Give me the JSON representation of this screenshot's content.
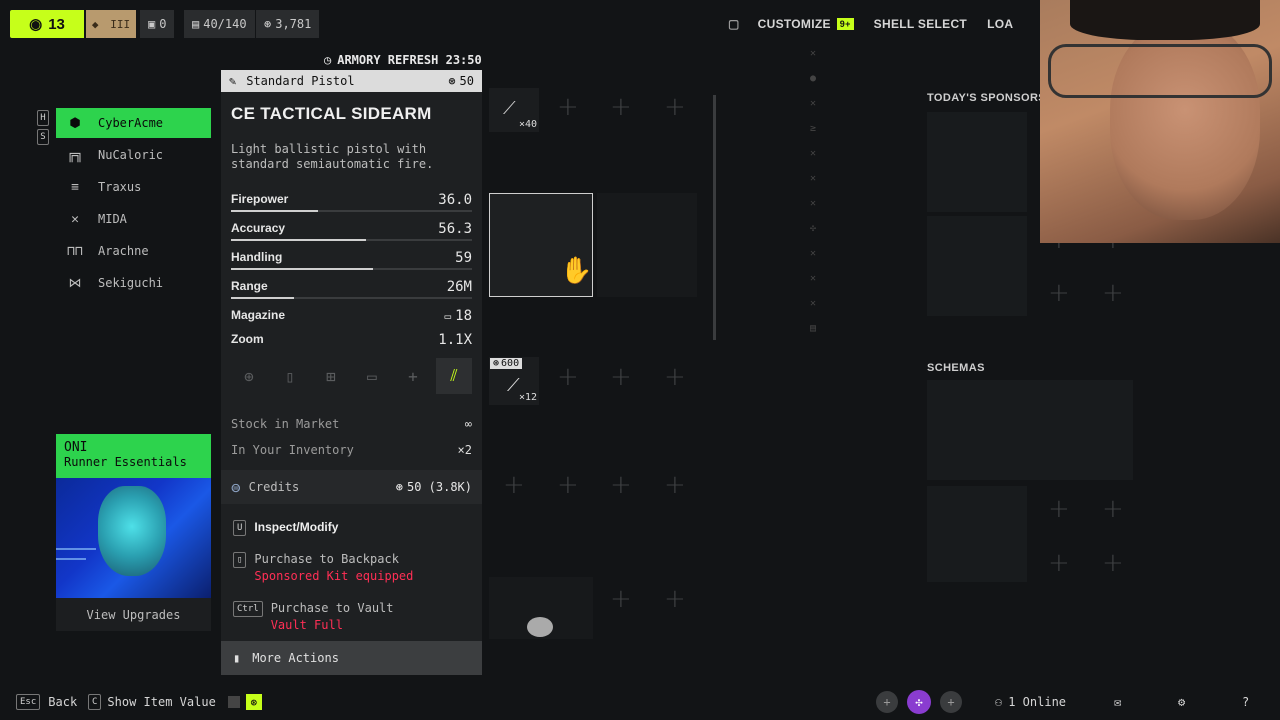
{
  "hud": {
    "level": "13",
    "tan_icons": [
      "◆",
      "III"
    ],
    "count_a": "0",
    "inventory": "40/140",
    "credits": "3,781"
  },
  "topnav": {
    "customize": "CUSTOMIZE",
    "customize_badge": "9+",
    "shell_select": "SHELL SELECT",
    "loadout": "LOA"
  },
  "armory_refresh": "ARMORY REFRESH 23:50",
  "sidebar": {
    "keys": [
      "H",
      "S"
    ],
    "items": [
      {
        "label": "CyberAcme",
        "icon": "⬢"
      },
      {
        "label": "NuCaloric",
        "icon": "╔╗"
      },
      {
        "label": "Traxus",
        "icon": "≡"
      },
      {
        "label": "MIDA",
        "icon": "✕"
      },
      {
        "label": "Arachne",
        "icon": "⊓⊓"
      },
      {
        "label": "Sekiguchi",
        "icon": "⋈"
      }
    ]
  },
  "item": {
    "category": "Standard Pistol",
    "price": "50",
    "name": "CE TACTICAL SIDEARM",
    "description": "Light ballistic pistol with standard semiautomatic fire.",
    "stats": [
      {
        "label": "Firepower",
        "value": "36.0",
        "fill": 0.36
      },
      {
        "label": "Accuracy",
        "value": "56.3",
        "fill": 0.56
      },
      {
        "label": "Handling",
        "value": "59",
        "fill": 0.59
      },
      {
        "label": "Range",
        "value": "26M",
        "fill": 0.26
      }
    ],
    "magazine_label": "Magazine",
    "magazine_value": "18",
    "zoom_label": "Zoom",
    "zoom_value": "1.1X",
    "stock_label": "Stock in Market",
    "stock_value": "∞",
    "inventory_label": "In Your Inventory",
    "inventory_value": "×2",
    "currency_label": "Credits",
    "currency_value": "50 (3.8K)"
  },
  "actions": {
    "inspect_key": "U",
    "inspect": "Inspect/Modify",
    "purchase_backpack": "Purchase to Backpack",
    "backpack_note": "Sponsored Kit equipped",
    "purchase_vault_key": "Ctrl",
    "purchase_vault": "Purchase to Vault",
    "vault_note": "Vault Full",
    "more": "More Actions"
  },
  "grid": {
    "item1_qty": "×40",
    "item2_price": "600",
    "item2_qty": "×12"
  },
  "oni": {
    "title": "ONI",
    "subtitle": "Runner Essentials",
    "button": "View Upgrades"
  },
  "right": {
    "sponsors": "TODAY'S SPONSORS",
    "schemas": "SCHEMAS"
  },
  "bottom": {
    "back": "Back",
    "back_key": "Esc",
    "show_value": "Show Item Value",
    "show_value_key": "C",
    "online": "1 Online"
  },
  "colors": {
    "accent": "#c6ff1a",
    "sponsor_green": "#2dd34d",
    "warning": "#ff2f55"
  }
}
